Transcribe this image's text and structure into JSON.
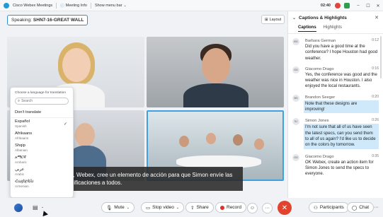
{
  "titlebar": {
    "app": "Cisco Webex Meetings",
    "meeting_info": "Meeting Info",
    "menu_bar": "Show menu bar",
    "time": "02:40"
  },
  "speaking": {
    "label": "Speaking:",
    "name": "SHN7-16-GREAT WALL"
  },
  "layout_button": "Layout",
  "caption_overlay": "uerdo, Webex, cree un elemento de acción para que Simon envíe las especificaciones a todos.",
  "language_menu": {
    "title": "Choose a language for translation",
    "search_placeholder": "Search",
    "dont_translate": "Don't translate",
    "languages": [
      {
        "name": "Español",
        "sub": "Spanish",
        "selected": true
      },
      {
        "name": "Afrikaans",
        "sub": "Afrikaans",
        "selected": false
      },
      {
        "name": "Shqip",
        "sub": "Albanian",
        "selected": false
      },
      {
        "name": "አማርኛ",
        "sub": "Amharic",
        "selected": false
      },
      {
        "name": "عربي",
        "sub": "Arabic",
        "selected": false
      },
      {
        "name": "Հայերեն",
        "sub": "Armenian",
        "selected": false
      }
    ],
    "check_glyph": "✓"
  },
  "panel": {
    "title": "Captions & Highlights",
    "tabs": [
      "Captions",
      "Highlights"
    ],
    "entries": [
      {
        "initials": "BG",
        "name": "Barbara German",
        "time": "0:12",
        "text": "Did you have a good time at the conference? I hope Houston had good weather.",
        "highlighted": false
      },
      {
        "initials": "GD",
        "name": "Giacomo Drago",
        "time": "0:16",
        "text": "Yes, the conference was good and the weather was nice in Houston. I also enjoyed the local restaurants.",
        "highlighted": false
      },
      {
        "initials": "BS",
        "name": "Brandon Seeger",
        "time": "0:20",
        "text": "Note that these designs are improving!",
        "highlighted": true
      },
      {
        "initials": "SJ",
        "name": "Simon Jones",
        "time": "0:26",
        "text": "I'm not sure that all of us have seen the latest specs, can you send them to all of us again? I'd like us to decide on the colors by tomorrow.",
        "highlighted": true
      },
      {
        "initials": "GD",
        "name": "Giacomo Drago",
        "time": "0:35",
        "text": "OK Webex, create an action item for Simon Jones to send the specs to everyone.",
        "highlighted": false
      }
    ]
  },
  "controls": {
    "mute": "Mute",
    "stop_video": "Stop video",
    "share": "Share",
    "record": "Record",
    "more": "···",
    "participants": "Participants",
    "chat": "Chat"
  },
  "colors": {
    "accent": "#2d8fd6",
    "end_call": "#e1432f",
    "highlight": "#cfe9fb",
    "record": "#d9342b"
  }
}
